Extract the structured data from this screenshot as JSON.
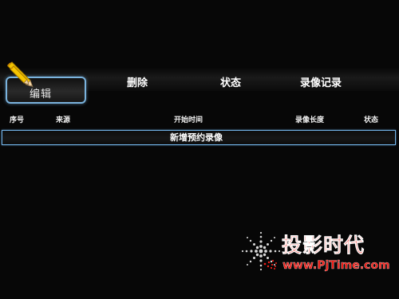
{
  "toolbar": {
    "edit_label": "编辑",
    "delete_label": "删除",
    "status_label": "状态",
    "record_log_label": "录像记录"
  },
  "table": {
    "headers": {
      "index": "序号",
      "source": "来源",
      "start_time": "开始时间",
      "duration": "录像长度",
      "state": "状态"
    },
    "new_recording_label": "新增预约录像"
  },
  "watermark": {
    "title": "投影时代",
    "url": "www.PjTime.com",
    "colors": {
      "red": "#f01f18",
      "outline": "#ffffff"
    }
  },
  "colors": {
    "background": "#070707",
    "accent": "#73b4ea",
    "text": "#f2f2f2"
  },
  "icons": {
    "edit": "pencil-icon",
    "watermark_logo": "dot-fan-logo-icon"
  }
}
